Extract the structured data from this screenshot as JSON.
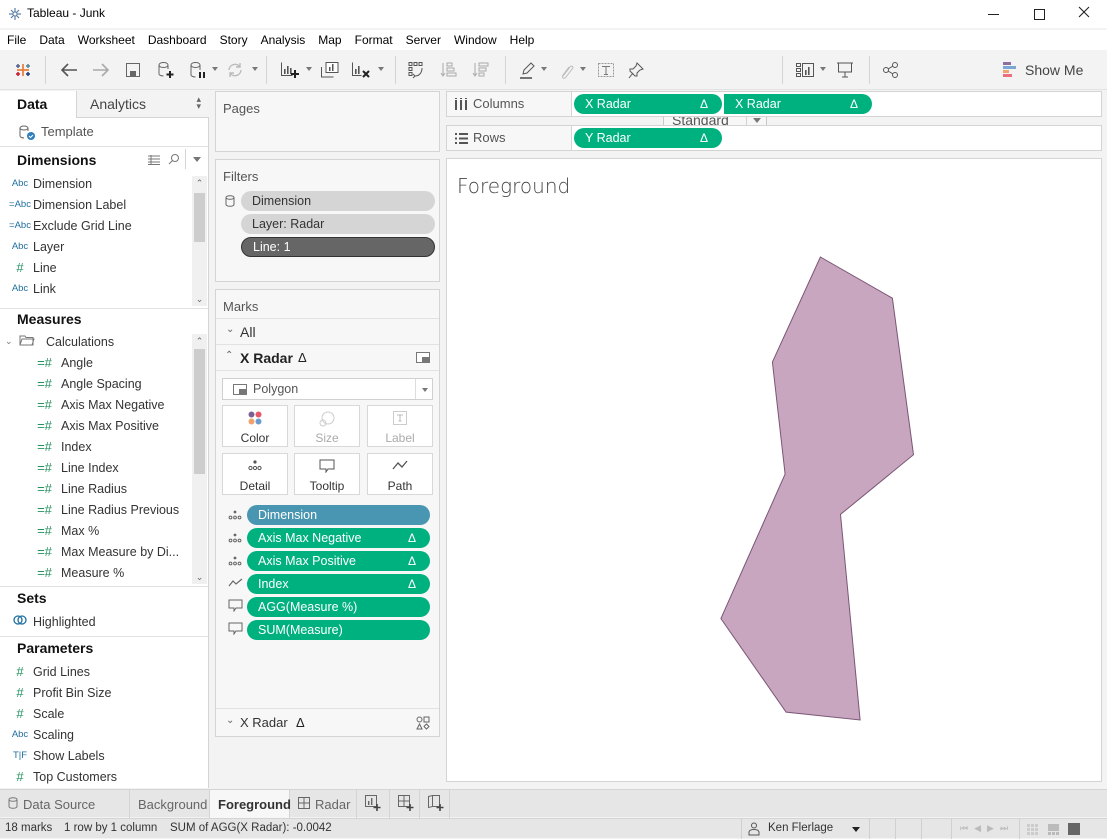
{
  "window": {
    "title": "Tableau - Junk",
    "controls": {
      "minimize": "—",
      "maximize": "☐",
      "close": "✕"
    }
  },
  "menu": [
    "File",
    "Data",
    "Worksheet",
    "Dashboard",
    "Story",
    "Analysis",
    "Map",
    "Format",
    "Server",
    "Window",
    "Help"
  ],
  "toolbar": {
    "icons": [
      "tableau-logo-icon",
      "undo-icon",
      "redo-icon",
      "save-icon",
      "new-data-source-icon",
      "pause-updates-icon",
      "refresh-icon",
      "new-worksheet-icon",
      "duplicate-sheet-icon",
      "clear-sheet-icon",
      "swap-rows-columns-icon",
      "sort-ascending-icon",
      "sort-descending-icon",
      "highlight-icon",
      "group-icon",
      "label-icon",
      "pin-icon",
      "view-cards-icon",
      "presentation-icon",
      "share-icon"
    ],
    "fit_select": "Standard",
    "show_me": "Show Me"
  },
  "data_pane": {
    "tabs": {
      "data": "Data",
      "analytics": "Analytics"
    },
    "data_source": "Template",
    "dimensions": {
      "title": "Dimensions",
      "items": [
        {
          "type": "Abc",
          "label": "Dimension"
        },
        {
          "type": "=Abc",
          "label": "Dimension Label"
        },
        {
          "type": "=Abc",
          "label": "Exclude Grid Line"
        },
        {
          "type": "Abc",
          "label": "Layer"
        },
        {
          "type": "#",
          "label": "Line"
        },
        {
          "type": "Abc",
          "label": "Link"
        }
      ]
    },
    "measures": {
      "title": "Measures",
      "folder": "Calculations",
      "items": [
        {
          "type": "=#",
          "label": "Angle"
        },
        {
          "type": "=#",
          "label": "Angle Spacing"
        },
        {
          "type": "=#",
          "label": "Axis Max Negative"
        },
        {
          "type": "=#",
          "label": "Axis Max Positive"
        },
        {
          "type": "=#",
          "label": "Index"
        },
        {
          "type": "=#",
          "label": "Line Index"
        },
        {
          "type": "=#",
          "label": "Line Radius"
        },
        {
          "type": "=#",
          "label": "Line Radius Previous"
        },
        {
          "type": "=#",
          "label": "Max %"
        },
        {
          "type": "=#",
          "label": "Max Measure by Di..."
        },
        {
          "type": "=#",
          "label": "Measure %"
        }
      ]
    },
    "sets": {
      "title": "Sets",
      "items": [
        {
          "label": "Highlighted"
        }
      ]
    },
    "parameters": {
      "title": "Parameters",
      "items": [
        {
          "type": "#",
          "label": "Grid Lines"
        },
        {
          "type": "#",
          "label": "Profit Bin Size"
        },
        {
          "type": "#",
          "label": "Scale"
        },
        {
          "type": "Abc",
          "label": "Scaling"
        },
        {
          "type": "T|F",
          "label": "Show Labels"
        },
        {
          "type": "#",
          "label": "Top Customers"
        }
      ]
    }
  },
  "pages": {
    "title": "Pages"
  },
  "filters": {
    "title": "Filters",
    "items": [
      "Dimension",
      "Layer: Radar",
      "Line: 1"
    ]
  },
  "marks": {
    "title": "Marks",
    "all_label": "All",
    "card_label": "X Radar",
    "mark_type": "Polygon",
    "buttons": [
      "Color",
      "Size",
      "Label",
      "Detail",
      "Tooltip",
      "Path"
    ],
    "pills": [
      {
        "role": "detail",
        "label": "Dimension",
        "calc": false,
        "color": "blue"
      },
      {
        "role": "detail",
        "label": "Axis Max Negative",
        "calc": true,
        "color": "green"
      },
      {
        "role": "detail",
        "label": "Axis Max Positive",
        "calc": true,
        "color": "green"
      },
      {
        "role": "path",
        "label": "Index",
        "calc": true,
        "color": "green"
      },
      {
        "role": "tooltip",
        "label": "AGG(Measure %)",
        "calc": false,
        "color": "green"
      },
      {
        "role": "tooltip",
        "label": "SUM(Measure)",
        "calc": false,
        "color": "green"
      }
    ],
    "second_card_label": "X Radar",
    "delta": "Δ"
  },
  "shelves": {
    "columns": {
      "label": "Columns",
      "pills": [
        "X Radar",
        "X Radar"
      ]
    },
    "rows": {
      "label": "Rows",
      "pills": [
        "Y Radar"
      ]
    }
  },
  "viz": {
    "title": "Foreground",
    "polygon": {
      "fill": "#c8a6bf",
      "stroke": "#7a5674",
      "points_norm": [
        [
          0.762,
          0.0
        ],
        [
          0.909,
          0.089
        ],
        [
          0.952,
          0.427
        ],
        [
          0.803,
          0.556
        ],
        [
          0.843,
          1.0
        ],
        [
          0.692,
          0.983
        ],
        [
          0.559,
          0.781
        ],
        [
          0.69,
          0.469
        ],
        [
          0.664,
          0.227
        ]
      ]
    }
  },
  "sheet_tabs": {
    "data_source": "Data Source",
    "sheets": [
      "Background",
      "Foreground",
      "Radar"
    ],
    "active": "Foreground"
  },
  "status": {
    "marks": "18 marks",
    "rows_cols": "1 row by 1 column",
    "sum": "SUM of AGG(X Radar): -0.0042",
    "user": "Ken Flerlage"
  }
}
